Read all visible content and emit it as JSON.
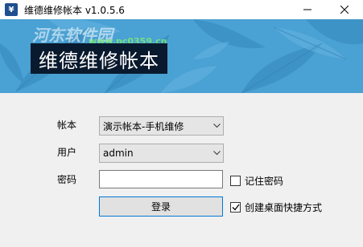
{
  "window": {
    "title": "维德维修帐本 v1.0.5.6",
    "icon_glyph": "¥"
  },
  "banner": {
    "title": "维德维修帐本",
    "watermark": "河东软件园",
    "watermark_url": "www.pc0359.cn"
  },
  "form": {
    "account_label": "帐本",
    "account_value": "演示帐本-手机维修",
    "user_label": "用户",
    "user_value": "admin",
    "password_label": "密码",
    "password_value": "",
    "remember_label": "记住密码",
    "remember_checked": false,
    "shortcut_label": "创建桌面快捷方式",
    "shortcut_checked": true,
    "login_label": "登录"
  },
  "colors": {
    "banner_bg": "#4aa1d3",
    "banner_title_bg": "#0a1a2e",
    "focus_border": "#0078d7"
  },
  "icons": [
    "app-icon",
    "minimize-icon",
    "close-icon",
    "chevron-down-icon",
    "checkmark-icon"
  ]
}
